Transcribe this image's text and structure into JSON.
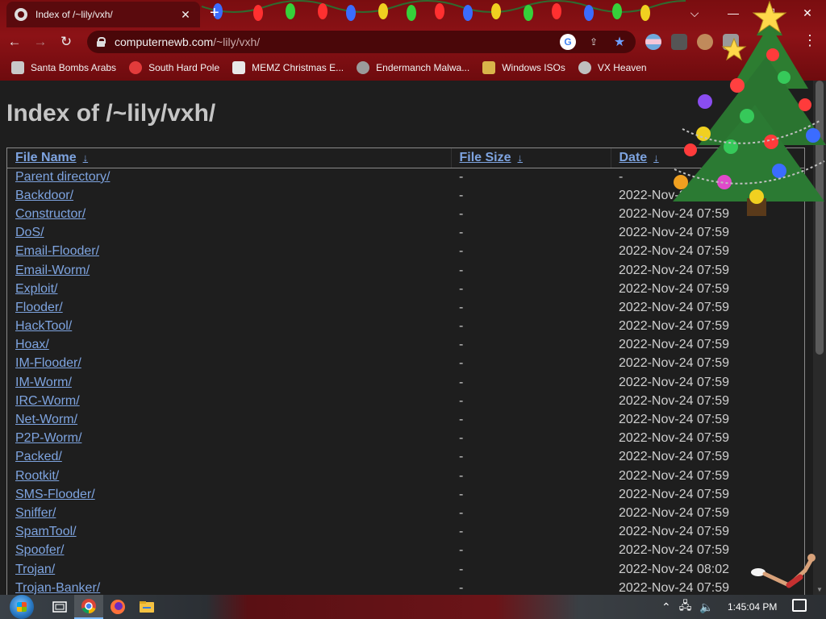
{
  "browser": {
    "tab_title": "Index of /~lily/vxh/",
    "tab_close": "✕",
    "new_tab": "+",
    "url_host": "computernewb.com",
    "url_path": "/~lily/vxh/",
    "window_controls": {
      "dropdown": "⌵",
      "minimize": "—",
      "maximize": "☐",
      "close": "✕"
    },
    "nav": {
      "back": "←",
      "forward": "→",
      "reload": "↻"
    },
    "menu": "⋮"
  },
  "bookmarks": [
    {
      "label": "Santa Bombs Arabs",
      "icon": "santa-icon",
      "color": "#c9c9c9"
    },
    {
      "label": "South Hard Pole",
      "icon": "snowflake-icon",
      "color": "#e23b3b"
    },
    {
      "label": "MEMZ Christmas E...",
      "icon": "page-icon",
      "color": "#e8e8e8"
    },
    {
      "label": "Endermanch Malwa...",
      "icon": "mascot-icon",
      "color": "#9b9b9b"
    },
    {
      "label": "Windows ISOs",
      "icon": "trophy-icon",
      "color": "#d9b44a"
    },
    {
      "label": "VX Heaven",
      "icon": "vx-icon",
      "color": "#bfbfbf"
    }
  ],
  "page": {
    "title": "Index of /~lily/vxh/",
    "columns": {
      "name": "File Name",
      "size": "File Size",
      "date": "Date",
      "sort_arrow": "↓"
    },
    "rows": [
      {
        "name": "Parent directory/",
        "size": "-",
        "date": "-"
      },
      {
        "name": "Backdoor/",
        "size": "-",
        "date": "2022-Nov-24 07:59"
      },
      {
        "name": "Constructor/",
        "size": "-",
        "date": "2022-Nov-24 07:59"
      },
      {
        "name": "DoS/",
        "size": "-",
        "date": "2022-Nov-24 07:59"
      },
      {
        "name": "Email-Flooder/",
        "size": "-",
        "date": "2022-Nov-24 07:59"
      },
      {
        "name": "Email-Worm/",
        "size": "-",
        "date": "2022-Nov-24 07:59"
      },
      {
        "name": "Exploit/",
        "size": "-",
        "date": "2022-Nov-24 07:59"
      },
      {
        "name": "Flooder/",
        "size": "-",
        "date": "2022-Nov-24 07:59"
      },
      {
        "name": "HackTool/",
        "size": "-",
        "date": "2022-Nov-24 07:59"
      },
      {
        "name": "Hoax/",
        "size": "-",
        "date": "2022-Nov-24 07:59"
      },
      {
        "name": "IM-Flooder/",
        "size": "-",
        "date": "2022-Nov-24 07:59"
      },
      {
        "name": "IM-Worm/",
        "size": "-",
        "date": "2022-Nov-24 07:59"
      },
      {
        "name": "IRC-Worm/",
        "size": "-",
        "date": "2022-Nov-24 07:59"
      },
      {
        "name": "Net-Worm/",
        "size": "-",
        "date": "2022-Nov-24 07:59"
      },
      {
        "name": "P2P-Worm/",
        "size": "-",
        "date": "2022-Nov-24 07:59"
      },
      {
        "name": "Packed/",
        "size": "-",
        "date": "2022-Nov-24 07:59"
      },
      {
        "name": "Rootkit/",
        "size": "-",
        "date": "2022-Nov-24 07:59"
      },
      {
        "name": "SMS-Flooder/",
        "size": "-",
        "date": "2022-Nov-24 07:59"
      },
      {
        "name": "Sniffer/",
        "size": "-",
        "date": "2022-Nov-24 07:59"
      },
      {
        "name": "SpamTool/",
        "size": "-",
        "date": "2022-Nov-24 07:59"
      },
      {
        "name": "Spoofer/",
        "size": "-",
        "date": "2022-Nov-24 07:59"
      },
      {
        "name": "Trojan/",
        "size": "-",
        "date": "2022-Nov-24 08:02"
      },
      {
        "name": "Trojan-Banker/",
        "size": "-",
        "date": "2022-Nov-24 07:59"
      }
    ]
  },
  "taskbar": {
    "clock": "1:45:04 PM",
    "apps": [
      "task-view-icon",
      "chrome-icon",
      "firefox-icon",
      "file-explorer-icon"
    ]
  },
  "colors": {
    "chrome_bg": "#8c1216",
    "link": "#7ea4e0",
    "page_bg": "#1e1e1e",
    "title_text": "#c5c5c5"
  }
}
